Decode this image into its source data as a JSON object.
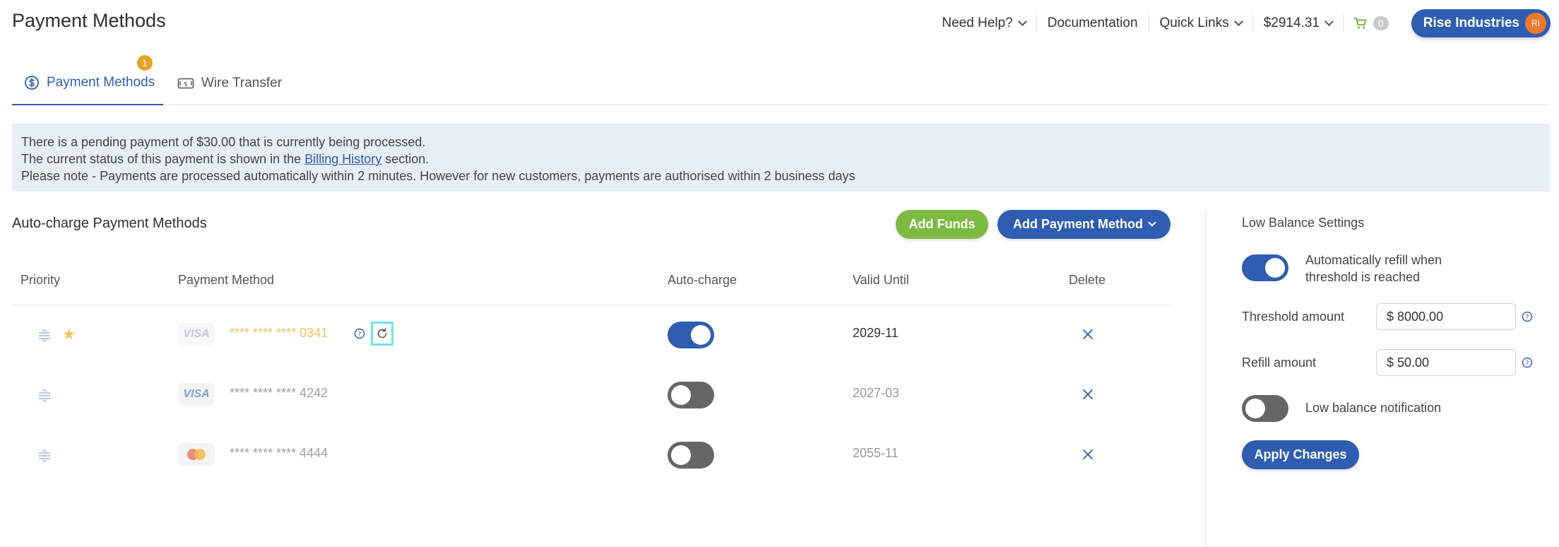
{
  "header": {
    "title": "Payment Methods",
    "nav": {
      "help": "Need Help?",
      "docs": "Documentation",
      "quick_links": "Quick Links",
      "balance": "$2914.31",
      "cart_count": "0"
    },
    "account": {
      "name": "Rise Industries",
      "initials": "RI"
    }
  },
  "tabs": [
    {
      "label": "Payment Methods",
      "badge": "1",
      "icon": "dollar-circle-icon",
      "active": true
    },
    {
      "label": "Wire Transfer",
      "icon": "banknote-icon",
      "active": false
    }
  ],
  "alert": {
    "line1": "There is a pending payment of $30.00 that is currently being processed.",
    "line2_before": "The current status of this payment is shown in the ",
    "line2_link": "Billing History",
    "line2_after": " section.",
    "line3": "Please note - Payments are processed automatically within 2 minutes. However for new customers, payments are authorised within 2 business days"
  },
  "autocharge": {
    "title": "Auto-charge Payment Methods",
    "add_funds": "Add Funds",
    "add_method": "Add Payment Method",
    "columns": {
      "priority": "Priority",
      "method": "Payment Method",
      "autocharge": "Auto-charge",
      "valid": "Valid Until",
      "delete": "Delete"
    },
    "rows": [
      {
        "brand": "VISA",
        "number": "**** **** **** 0341",
        "autocharge": true,
        "valid": "2029-11",
        "primary": true
      },
      {
        "brand": "VISA",
        "number": "**** **** **** 4242",
        "autocharge": false,
        "valid": "2027-03",
        "primary": false
      },
      {
        "brand": "mastercard",
        "number": "**** **** **** 4444",
        "autocharge": false,
        "valid": "2055-11",
        "primary": false
      }
    ]
  },
  "low_balance": {
    "title": "Low Balance Settings",
    "auto_refill_line1": "Automatically refill when",
    "auto_refill_line2": "threshold is reached",
    "auto_refill_on": true,
    "threshold_label": "Threshold amount",
    "threshold_value": "$ 8000.00",
    "refill_label": "Refill amount",
    "refill_value": "$ 50.00",
    "notification_label": "Low balance notification",
    "notification_on": false,
    "apply": "Apply Changes"
  },
  "colors": {
    "primary": "#2f5db2",
    "green": "#7cba42",
    "badge": "#e6a329",
    "alert_bg": "#e8eef6"
  }
}
